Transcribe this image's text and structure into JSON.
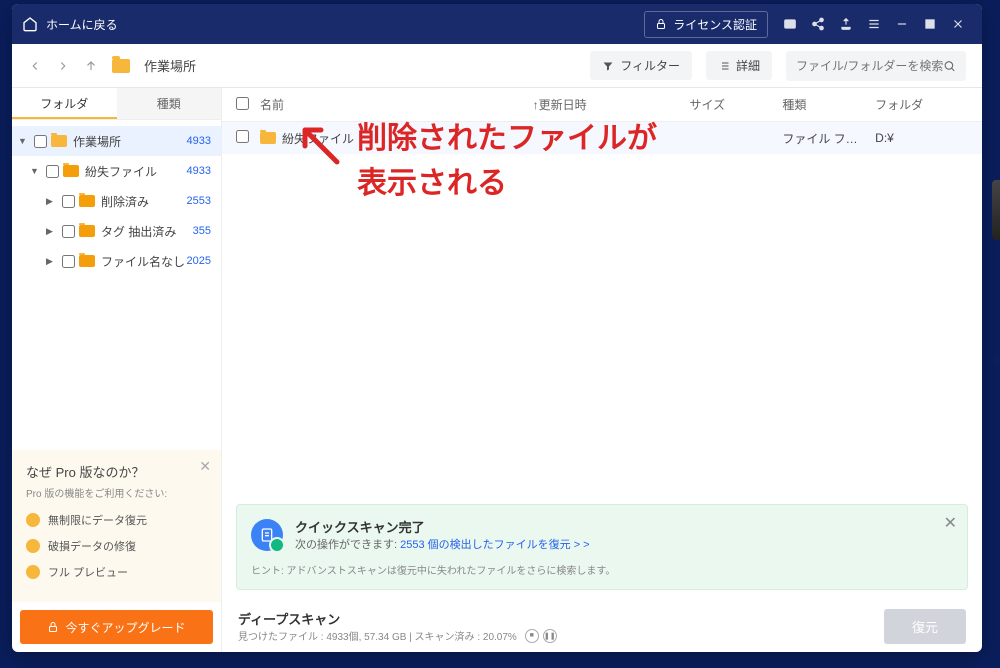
{
  "titlebar": {
    "home": "ホームに戻る",
    "license": "ライセンス認証"
  },
  "toolbar": {
    "breadcrumb": "作業場所",
    "filter": "フィルター",
    "detail": "詳細",
    "search_placeholder": "ファイル/フォルダーを検索"
  },
  "tabs": {
    "folder": "フォルダ",
    "type": "種類"
  },
  "tree": [
    {
      "label": "作業場所",
      "count": "4933",
      "depth": 0,
      "active": true,
      "open": true
    },
    {
      "label": "紛失ファイル",
      "count": "4933",
      "depth": 1,
      "open": true
    },
    {
      "label": "削除済み",
      "count": "2553",
      "depth": 2
    },
    {
      "label": "タグ 抽出済み",
      "count": "355",
      "depth": 2
    },
    {
      "label": "ファイル名なし",
      "count": "2025",
      "depth": 2
    }
  ],
  "cols": {
    "name": "名前",
    "date": "更新日時",
    "size": "サイズ",
    "type": "種類",
    "folder": "フォルダ"
  },
  "row": {
    "name": "紛失ファイル",
    "type": "ファイル フ…",
    "folder": "D:¥"
  },
  "annot": {
    "line1": "削除されたファイルが",
    "line2": "表示される"
  },
  "quick": {
    "title": "クイックスキャン完了",
    "desc_prefix": "次の操作ができます:",
    "desc_link": "2553 個の検出したファイルを復元 > >",
    "hint": "ヒント: アドバンストスキャンは復元中に失われたファイルをさらに検索します。"
  },
  "promo": {
    "title": "なぜ Pro 版なのか？",
    "sub": "Pro 版の機能をご利用ください:",
    "features": [
      "無制限にデータ復元",
      "破損データの修復",
      "フル プレビュー"
    ],
    "upgrade": "今すぐアップグレード"
  },
  "footer": {
    "title": "ディープスキャン",
    "stats": "見つけたファイル : 4933個,  57.34 GB | スキャン済み : 20.07%",
    "restore": "復元"
  }
}
